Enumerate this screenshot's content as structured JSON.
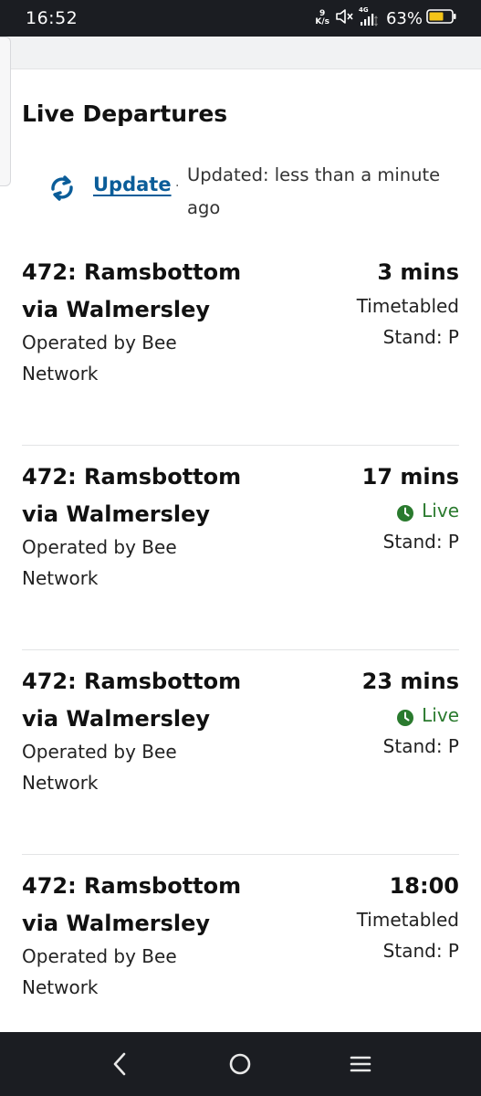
{
  "status_bar": {
    "time": "16:52",
    "net_speed_value": "9",
    "net_speed_unit": "K/s",
    "network_type": "4G",
    "battery": "63%",
    "icons": [
      "mute-icon",
      "signal-icon",
      "battery-icon"
    ]
  },
  "page": {
    "section_title": "Live Departures",
    "update_label": "Update",
    "separator": "·",
    "updated_text": "Updated: less than a minute ago",
    "accent_color": "#0b5d99",
    "live_color": "#2a7a2e"
  },
  "departures": [
    {
      "route": "472: Ramsbottom via Walmersley",
      "operator": "Operated by Bee Network",
      "due": "3 mins",
      "status": "Timetabled",
      "live": false,
      "stand": "Stand: P"
    },
    {
      "route": "472: Ramsbottom via Walmersley",
      "operator": "Operated by Bee Network",
      "due": "17 mins",
      "status": "Live",
      "live": true,
      "stand": "Stand: P"
    },
    {
      "route": "472: Ramsbottom via Walmersley",
      "operator": "Operated by Bee Network",
      "due": "23 mins",
      "status": "Live",
      "live": true,
      "stand": "Stand: P"
    },
    {
      "route": "472: Ramsbottom via Walmersley",
      "operator": "Operated by Bee Network",
      "due": "18:00",
      "status": "Timetabled",
      "live": false,
      "stand": "Stand: P"
    }
  ],
  "nav_bar": {
    "icons": [
      "back-icon",
      "home-icon",
      "menu-icon"
    ]
  }
}
